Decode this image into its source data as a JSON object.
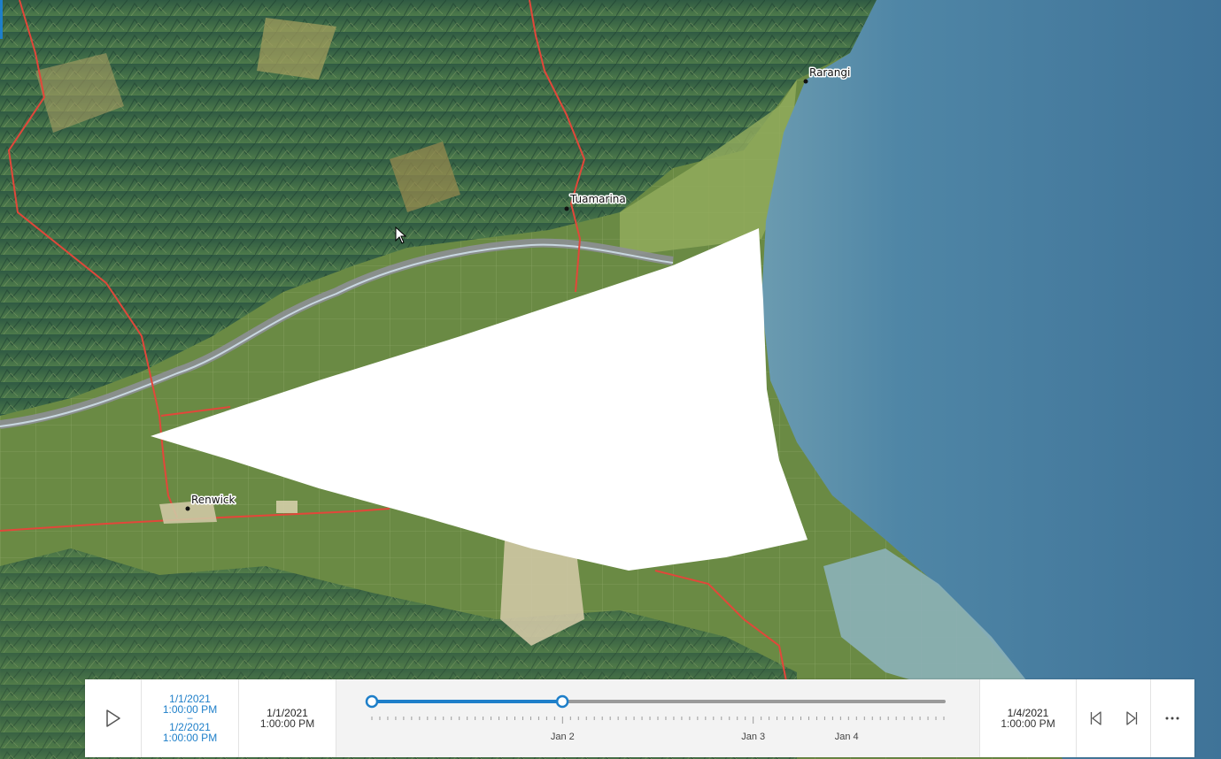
{
  "map": {
    "places": [
      {
        "name": "Rarangi"
      },
      {
        "name": "Tuamarina"
      },
      {
        "name": "Renwick"
      }
    ],
    "colors": {
      "sea": "#4f86a6",
      "sea_shallow": "#7ea9b7",
      "land": "#6b8c46",
      "hills": "#3d6a4e",
      "road": "#e2473a",
      "river": "#8e8f99",
      "town": "#cfc7a4",
      "occlusion": "#ffffff"
    }
  },
  "time_slider": {
    "current_range": {
      "start_date": "1/1/2021",
      "start_time": "1:00:00 PM",
      "separator": "–",
      "end_date": "1/2/2021",
      "end_time": "1:00:00 PM"
    },
    "min": {
      "date": "1/1/2021",
      "time": "1:00:00 PM"
    },
    "max": {
      "date": "1/4/2021",
      "time": "1:00:00 PM"
    },
    "tick_labels": [
      "Jan 2",
      "Jan 3",
      "Jan 4"
    ],
    "thumb_start_fraction": 0.0,
    "thumb_end_fraction": 0.333,
    "accent_color": "#1e7fc9",
    "icons": {
      "play": "play-icon",
      "previous": "step-back-icon",
      "next": "step-forward-icon",
      "menu": "more-icon"
    }
  }
}
